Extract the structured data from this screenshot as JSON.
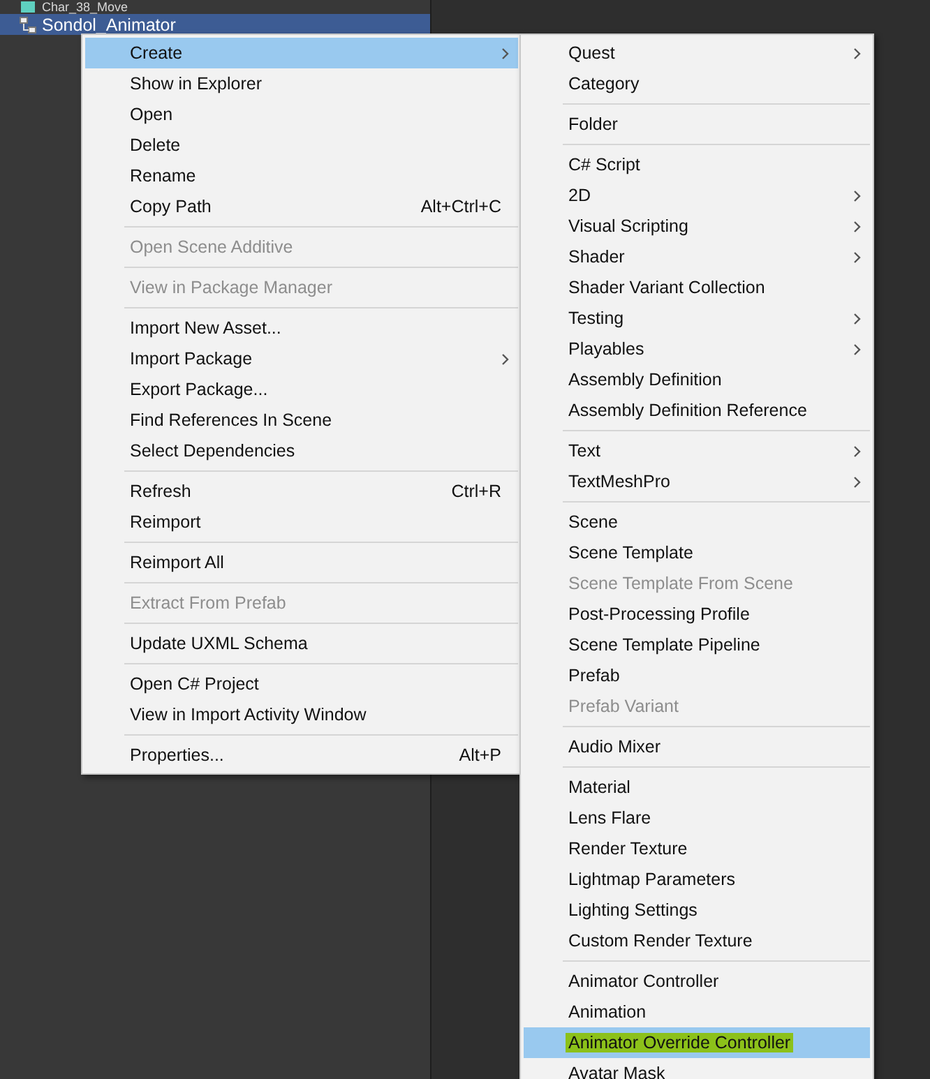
{
  "project_tree": [
    {
      "label": "Char_38_Move",
      "kind": "file",
      "selected": false
    },
    {
      "label": "Sondol_Animator",
      "kind": "animator",
      "selected": true
    }
  ],
  "context_menu": [
    {
      "kind": "item",
      "label": "Create",
      "submenu": true,
      "selected": true,
      "disabled": false
    },
    {
      "kind": "item",
      "label": "Show in Explorer",
      "selected": false,
      "disabled": false
    },
    {
      "kind": "item",
      "label": "Open",
      "selected": false,
      "disabled": false
    },
    {
      "kind": "item",
      "label": "Delete",
      "selected": false,
      "disabled": false
    },
    {
      "kind": "item",
      "label": "Rename",
      "selected": false,
      "disabled": false
    },
    {
      "kind": "item",
      "label": "Copy Path",
      "shortcut": "Alt+Ctrl+C",
      "selected": false,
      "disabled": false
    },
    {
      "kind": "separator"
    },
    {
      "kind": "item",
      "label": "Open Scene Additive",
      "selected": false,
      "disabled": true
    },
    {
      "kind": "separator"
    },
    {
      "kind": "item",
      "label": "View in Package Manager",
      "selected": false,
      "disabled": true
    },
    {
      "kind": "separator"
    },
    {
      "kind": "item",
      "label": "Import New Asset...",
      "selected": false,
      "disabled": false
    },
    {
      "kind": "item",
      "label": "Import Package",
      "submenu": true,
      "selected": false,
      "disabled": false
    },
    {
      "kind": "item",
      "label": "Export Package...",
      "selected": false,
      "disabled": false
    },
    {
      "kind": "item",
      "label": "Find References In Scene",
      "selected": false,
      "disabled": false
    },
    {
      "kind": "item",
      "label": "Select Dependencies",
      "selected": false,
      "disabled": false
    },
    {
      "kind": "separator"
    },
    {
      "kind": "item",
      "label": "Refresh",
      "shortcut": "Ctrl+R",
      "selected": false,
      "disabled": false
    },
    {
      "kind": "item",
      "label": "Reimport",
      "selected": false,
      "disabled": false
    },
    {
      "kind": "separator"
    },
    {
      "kind": "item",
      "label": "Reimport All",
      "selected": false,
      "disabled": false
    },
    {
      "kind": "separator"
    },
    {
      "kind": "item",
      "label": "Extract From Prefab",
      "selected": false,
      "disabled": true
    },
    {
      "kind": "separator"
    },
    {
      "kind": "item",
      "label": "Update UXML Schema",
      "selected": false,
      "disabled": false
    },
    {
      "kind": "separator"
    },
    {
      "kind": "item",
      "label": "Open C# Project",
      "selected": false,
      "disabled": false
    },
    {
      "kind": "item",
      "label": "View in Import Activity Window",
      "selected": false,
      "disabled": false
    },
    {
      "kind": "separator"
    },
    {
      "kind": "item",
      "label": "Properties...",
      "shortcut": "Alt+P",
      "selected": false,
      "disabled": false
    }
  ],
  "create_submenu": [
    {
      "kind": "item",
      "label": "Quest",
      "submenu": true,
      "selected": false,
      "disabled": false
    },
    {
      "kind": "item",
      "label": "Category",
      "selected": false,
      "disabled": false
    },
    {
      "kind": "separator"
    },
    {
      "kind": "item",
      "label": "Folder",
      "selected": false,
      "disabled": false
    },
    {
      "kind": "separator"
    },
    {
      "kind": "item",
      "label": "C# Script",
      "selected": false,
      "disabled": false
    },
    {
      "kind": "item",
      "label": "2D",
      "submenu": true,
      "selected": false,
      "disabled": false
    },
    {
      "kind": "item",
      "label": "Visual Scripting",
      "submenu": true,
      "selected": false,
      "disabled": false
    },
    {
      "kind": "item",
      "label": "Shader",
      "submenu": true,
      "selected": false,
      "disabled": false
    },
    {
      "kind": "item",
      "label": "Shader Variant Collection",
      "selected": false,
      "disabled": false
    },
    {
      "kind": "item",
      "label": "Testing",
      "submenu": true,
      "selected": false,
      "disabled": false
    },
    {
      "kind": "item",
      "label": "Playables",
      "submenu": true,
      "selected": false,
      "disabled": false
    },
    {
      "kind": "item",
      "label": "Assembly Definition",
      "selected": false,
      "disabled": false
    },
    {
      "kind": "item",
      "label": "Assembly Definition Reference",
      "selected": false,
      "disabled": false
    },
    {
      "kind": "separator"
    },
    {
      "kind": "item",
      "label": "Text",
      "submenu": true,
      "selected": false,
      "disabled": false
    },
    {
      "kind": "item",
      "label": "TextMeshPro",
      "submenu": true,
      "selected": false,
      "disabled": false
    },
    {
      "kind": "separator"
    },
    {
      "kind": "item",
      "label": "Scene",
      "selected": false,
      "disabled": false
    },
    {
      "kind": "item",
      "label": "Scene Template",
      "selected": false,
      "disabled": false
    },
    {
      "kind": "item",
      "label": "Scene Template From Scene",
      "selected": false,
      "disabled": true
    },
    {
      "kind": "item",
      "label": "Post-Processing Profile",
      "selected": false,
      "disabled": false
    },
    {
      "kind": "item",
      "label": "Scene Template Pipeline",
      "selected": false,
      "disabled": false
    },
    {
      "kind": "item",
      "label": "Prefab",
      "selected": false,
      "disabled": false
    },
    {
      "kind": "item",
      "label": "Prefab Variant",
      "selected": false,
      "disabled": true
    },
    {
      "kind": "separator"
    },
    {
      "kind": "item",
      "label": "Audio Mixer",
      "selected": false,
      "disabled": false
    },
    {
      "kind": "separator"
    },
    {
      "kind": "item",
      "label": "Material",
      "selected": false,
      "disabled": false
    },
    {
      "kind": "item",
      "label": "Lens Flare",
      "selected": false,
      "disabled": false
    },
    {
      "kind": "item",
      "label": "Render Texture",
      "selected": false,
      "disabled": false
    },
    {
      "kind": "item",
      "label": "Lightmap Parameters",
      "selected": false,
      "disabled": false
    },
    {
      "kind": "item",
      "label": "Lighting Settings",
      "selected": false,
      "disabled": false
    },
    {
      "kind": "item",
      "label": "Custom Render Texture",
      "selected": false,
      "disabled": false
    },
    {
      "kind": "separator"
    },
    {
      "kind": "item",
      "label": "Animator Controller",
      "selected": false,
      "disabled": false
    },
    {
      "kind": "item",
      "label": "Animation",
      "selected": false,
      "disabled": false
    },
    {
      "kind": "item",
      "label": "Animator Override Controller",
      "selected": true,
      "disabled": false,
      "marked": true
    },
    {
      "kind": "item",
      "label": "Avatar Mask",
      "selected": false,
      "disabled": false
    }
  ]
}
